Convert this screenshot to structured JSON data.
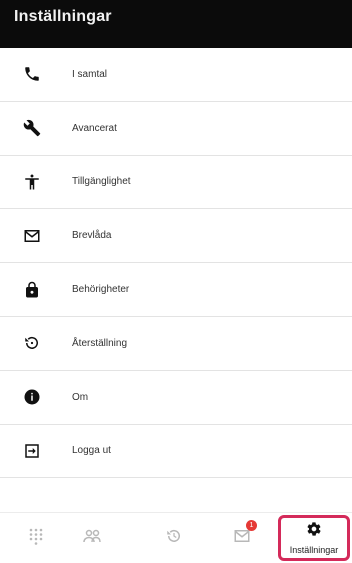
{
  "header": {
    "title": "Inställningar"
  },
  "menu": [
    {
      "label": "I samtal",
      "icon": "phone-icon"
    },
    {
      "label": "Avancerat",
      "icon": "wrench-icon"
    },
    {
      "label": "Tillgänglighet",
      "icon": "accessibility-icon"
    },
    {
      "label": "Brevlåda",
      "icon": "mail-icon"
    },
    {
      "label": "Behörigheter",
      "icon": "lock-icon"
    },
    {
      "label": "Återställning",
      "icon": "restore-icon"
    },
    {
      "label": "Om",
      "icon": "info-icon"
    },
    {
      "label": "Logga ut",
      "icon": "logout-icon"
    }
  ],
  "bottom_nav": {
    "tabs": [
      {
        "name": "keypad",
        "icon": "dialpad-icon"
      },
      {
        "name": "contacts",
        "icon": "contacts-icon"
      },
      {
        "name": "history",
        "icon": "history-icon"
      },
      {
        "name": "voicemail",
        "icon": "mail-icon",
        "badge": "1"
      },
      {
        "name": "settings",
        "icon": "gear-icon",
        "label": "Inställningar",
        "active": true
      }
    ]
  },
  "colors": {
    "header_bg": "#0b0b0b",
    "highlight": "#d42a5a",
    "badge": "#e53935"
  }
}
